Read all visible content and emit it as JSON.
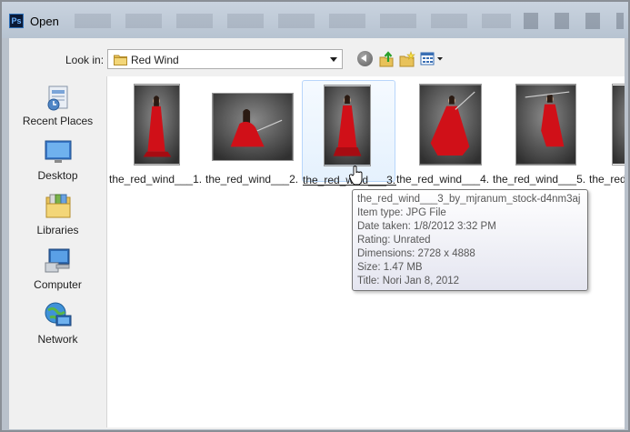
{
  "window": {
    "title": "Open",
    "app_icon_text": "Ps"
  },
  "toolbar": {
    "look_in_label": "Look in:",
    "look_in_value": "Red Wind"
  },
  "places": [
    {
      "label": "Recent Places",
      "icon": "recent-places-icon"
    },
    {
      "label": "Desktop",
      "icon": "desktop-icon"
    },
    {
      "label": "Libraries",
      "icon": "libraries-icon"
    },
    {
      "label": "Computer",
      "icon": "computer-icon"
    },
    {
      "label": "Network",
      "icon": "network-icon"
    }
  ],
  "files": [
    {
      "label": "the_red_wind___1..."
    },
    {
      "label": "the_red_wind___2..."
    },
    {
      "label": "the_red_wind___3..."
    },
    {
      "label": "the_red_wind___4..."
    },
    {
      "label": "the_red_wind___5..."
    },
    {
      "label": "the_red"
    }
  ],
  "tooltip": {
    "name": "the_red_wind___3_by_mjranum_stock-d4nm3aj",
    "item_type": "Item type: JPG File",
    "date_taken": "Date taken: 1/8/2012 3:32 PM",
    "rating": "Rating: Unrated",
    "dimensions": "Dimensions: 2728 x 4888",
    "size": "Size: 1.47 MB",
    "title": "Title: Nori Jan 8, 2012"
  },
  "colors": {
    "selection_border": "#b8d6fb",
    "dress_red": "#d01018",
    "photo_backdrop": "#4a4a4a"
  }
}
